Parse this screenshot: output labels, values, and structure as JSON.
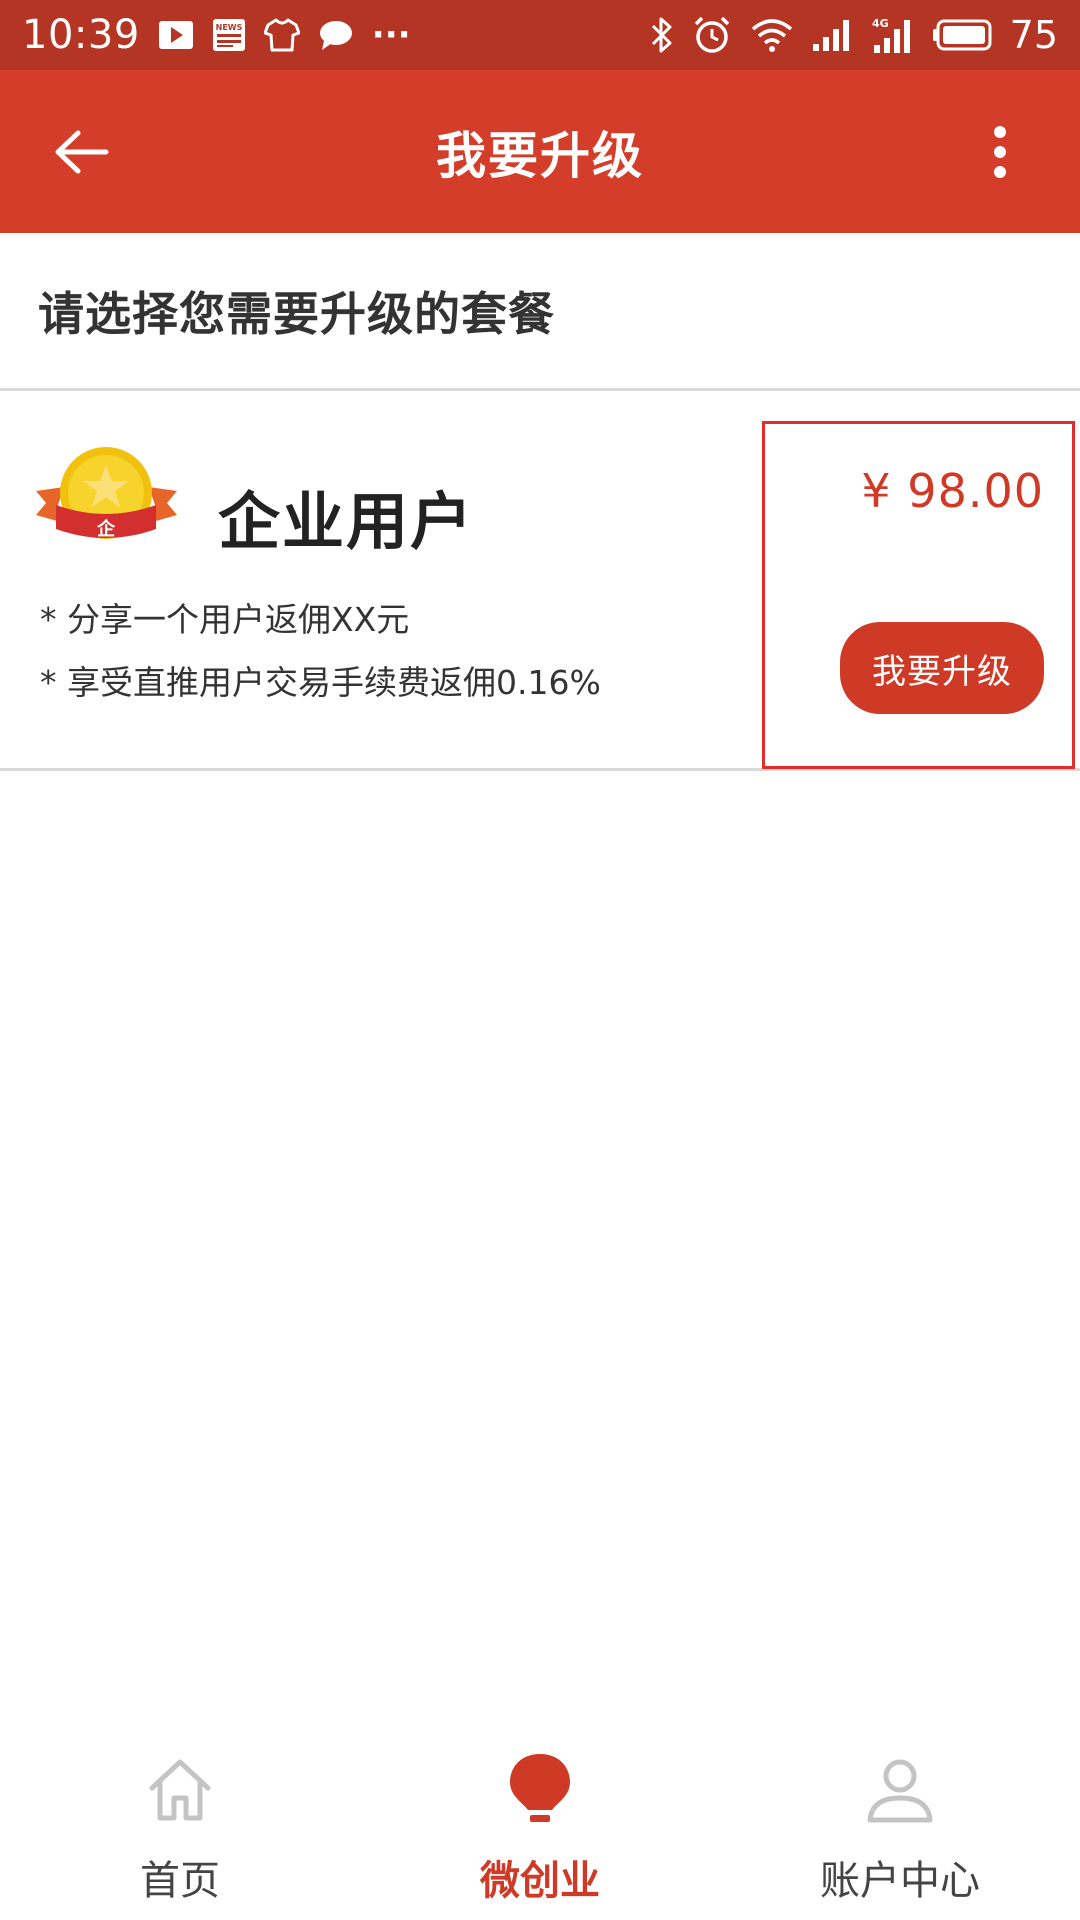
{
  "status_bar": {
    "time": "10:39",
    "news_badge": "NEWS",
    "more_dots": "···",
    "network_type": "4G",
    "battery_level": "75"
  },
  "app_bar": {
    "title": "我要升级"
  },
  "section": {
    "title": "请选择您需要升级的套餐"
  },
  "plan": {
    "badge_char": "企",
    "name": "企业用户",
    "benefits": [
      "* 分享一个用户返佣XX元",
      "* 享受直推用户交易手续费返佣0.16%"
    ],
    "price": "¥ 98.00",
    "upgrade_label": "我要升级"
  },
  "bottom_nav": {
    "items": [
      {
        "label": "首页",
        "icon": "home-icon",
        "active": false
      },
      {
        "label": "微创业",
        "icon": "lightbulb-icon",
        "active": true
      },
      {
        "label": "账户中心",
        "icon": "user-icon",
        "active": false
      }
    ]
  },
  "colors": {
    "status_bar": "#b53525",
    "app_bar": "#d33d29",
    "accent": "#cf3a27",
    "highlight_border": "#e52b2b"
  }
}
